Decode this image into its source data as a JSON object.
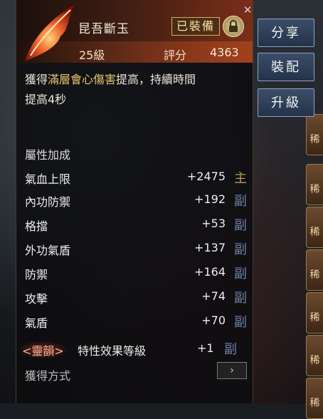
{
  "item": {
    "name": "昆吾斷玉",
    "equipped_badge": "已裝備",
    "level": "25級",
    "score_label": "評分",
    "score_value": "4363"
  },
  "description": {
    "line1_pre": "獲得",
    "line1_hl": "滿層會心傷害",
    "line1_post": "提高，持續時間",
    "line2": "提高4秒"
  },
  "section_title": "屬性加成",
  "stats": [
    {
      "name": "氣血上限",
      "value": "+2475",
      "tag": "主"
    },
    {
      "name": "內功防禦",
      "value": "+192",
      "tag": "副"
    },
    {
      "name": "格擋",
      "value": "+53",
      "tag": "副"
    },
    {
      "name": "外功氣盾",
      "value": "+137",
      "tag": "副"
    },
    {
      "name": "防禦",
      "value": "+164",
      "tag": "副"
    },
    {
      "name": "攻擊",
      "value": "+74",
      "tag": "副"
    },
    {
      "name": "氣盾",
      "value": "+70",
      "tag": "副"
    }
  ],
  "trait": {
    "prefix": "<靈韻>",
    "name": "特性效果等級",
    "value": "+1",
    "tag": "副"
  },
  "obtain_label": "獲得方式",
  "buttons": {
    "share": "分享",
    "equip": "裝配",
    "upgrade": "升級"
  },
  "side_slots": [
    "稀",
    "稀",
    "稀",
    "稀",
    "稀",
    "稀",
    "稀"
  ],
  "colors": {
    "highlight": "#e5c36a",
    "main_tag": "#b99a5a",
    "sub_tag": "#6e82a6"
  }
}
